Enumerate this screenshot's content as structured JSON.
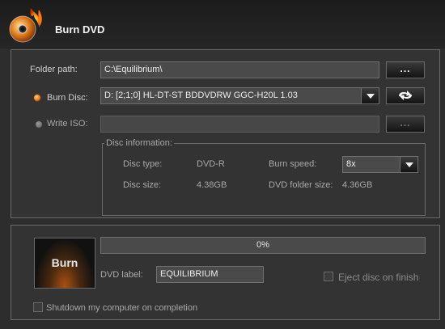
{
  "header": {
    "title": "Burn DVD",
    "logo_icon": "burning-disc-icon"
  },
  "folder": {
    "label": "Folder path:",
    "value": "C:\\Equilibrium\\",
    "browse_label": "..."
  },
  "burn_disc": {
    "label": "Burn Disc:",
    "selected": true,
    "drive": "D:  [2;1;0] HL-DT-ST BDDVDRW GGC-H20L 1.03",
    "refresh_icon": "refresh-icon"
  },
  "write_iso": {
    "label": "Write ISO:",
    "selected": false,
    "value": "",
    "browse_label": "..."
  },
  "disc_info": {
    "legend": "Disc information:",
    "disc_type_label": "Disc type:",
    "disc_type": "DVD-R",
    "disc_size_label": "Disc size:",
    "disc_size": "4.38GB",
    "burn_speed_label": "Burn speed:",
    "burn_speed": "8x",
    "folder_size_label": "DVD folder size:",
    "folder_size": "4.36GB"
  },
  "burn": {
    "button_label": "Burn",
    "progress_text": "0%",
    "progress_value": 0,
    "dvd_label_label": "DVD label:",
    "dvd_label": "EQUILIBRIUM",
    "eject_label": "Eject disc on finish",
    "eject_checked": false,
    "shutdown_label": "Shutdown my computer on completion",
    "shutdown_checked": false
  },
  "colors": {
    "accent": "#e07818",
    "background": "#2d2d2d",
    "panel": "#333333"
  }
}
